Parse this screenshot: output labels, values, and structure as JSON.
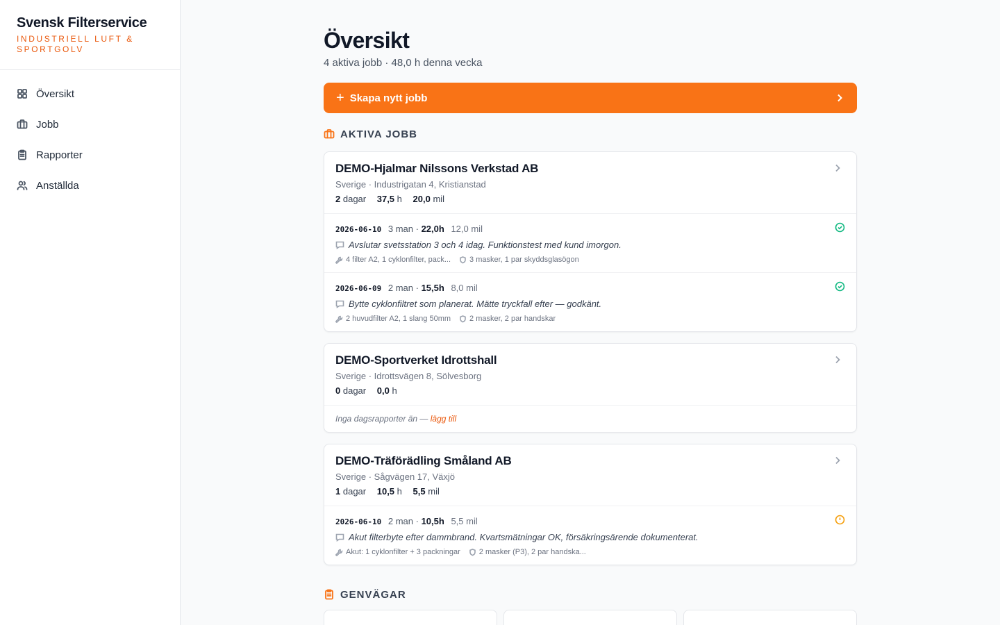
{
  "sidebar": {
    "brand_name": "Svensk Filterservice",
    "brand_tag": "INDUSTRIELL LUFT & SPORTGOLV",
    "items": [
      {
        "label": "Översikt",
        "icon": "grid-icon"
      },
      {
        "label": "Jobb",
        "icon": "briefcase-icon"
      },
      {
        "label": "Rapporter",
        "icon": "clipboard-icon"
      },
      {
        "label": "Anställda",
        "icon": "users-icon"
      }
    ]
  },
  "header": {
    "title": "Översikt",
    "subtitle": "4 aktiva jobb · 48,0 h denna vecka"
  },
  "cta": {
    "plus": "+",
    "label": "Skapa nytt jobb"
  },
  "sections": {
    "active": "AKTIVA JOBB",
    "shortcuts": "GENVÄGAR"
  },
  "jobs": [
    {
      "title": "DEMO-Hjalmar Nilssons Verkstad AB",
      "address": "Sverige · Industrigatan 4, Kristianstad",
      "days": "2",
      "days_unit": "dagar",
      "hours": "37,5",
      "hours_unit": "h",
      "mil": "20,0",
      "mil_unit": "mil",
      "reports": [
        {
          "date": "2026-06-10",
          "crew": "3 man ·",
          "hours": "22,0h",
          "mil": "12,0 mil",
          "note": "Avslutar svetsstation 3 och 4 idag. Funktionstest med kund imorgon.",
          "materials": "4 filter A2, 1 cyklonfilter, pack...",
          "ppe": "3 masker, 1 par skyddsglasögon",
          "status": "ok"
        },
        {
          "date": "2026-06-09",
          "crew": "2 man ·",
          "hours": "15,5h",
          "mil": "8,0 mil",
          "note": "Bytte cyklonfiltret som planerat. Mätte tryckfall efter — godkänt.",
          "materials": "2 huvudfilter A2, 1 slang 50mm",
          "ppe": "2 masker, 2 par handskar",
          "status": "ok"
        }
      ]
    },
    {
      "title": "DEMO-Sportverket Idrottshall",
      "address": "Sverige · Idrottsvägen 8, Sölvesborg",
      "days": "0",
      "days_unit": "dagar",
      "hours": "0,0",
      "hours_unit": "h",
      "empty_text": "Inga dagsrapporter än —",
      "empty_link": "lägg till"
    },
    {
      "title": "DEMO-Träförädling Småland AB",
      "address": "Sverige · Sågvägen 17, Växjö",
      "days": "1",
      "days_unit": "dagar",
      "hours": "10,5",
      "hours_unit": "h",
      "mil": "5,5",
      "mil_unit": "mil",
      "reports": [
        {
          "date": "2026-06-10",
          "crew": "2 man ·",
          "hours": "10,5h",
          "mil": "5,5 mil",
          "note": "Akut filterbyte efter dammbrand. Kvartsmätningar OK, försäkringsärende dokumenterat.",
          "materials": "Akut: 1 cyklonfilter + 3 packningar",
          "ppe": "2 masker (P3), 2 par handska...",
          "status": "warn"
        }
      ]
    }
  ],
  "colors": {
    "accent": "#f97316",
    "brand_tag": "#ea580c",
    "status_ok": "#10b981",
    "status_warn": "#f59e0b"
  }
}
